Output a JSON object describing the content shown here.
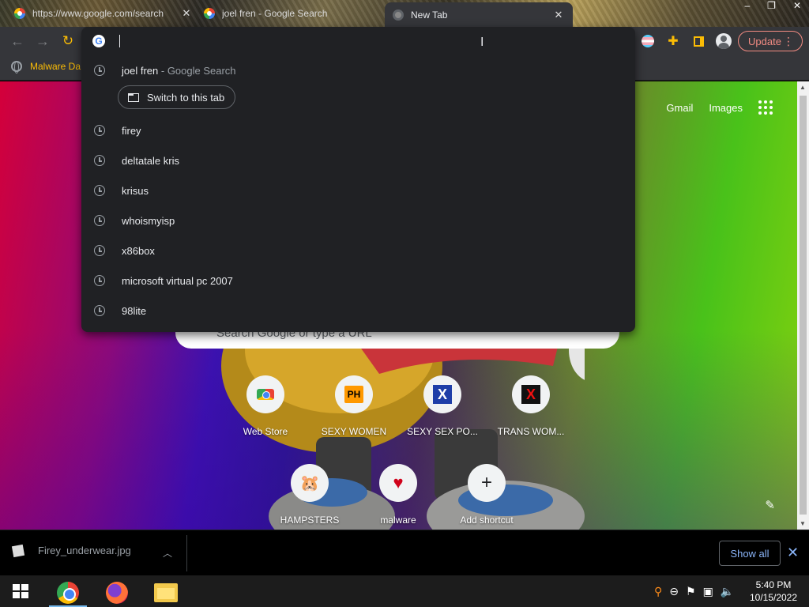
{
  "tabs": [
    {
      "title": "https://www.google.com/search",
      "icon": "google-icon"
    },
    {
      "title": "joel fren - Google Search",
      "icon": "google-icon"
    },
    {
      "title": "New Tab",
      "icon": "chrome-icon"
    }
  ],
  "window_controls": {
    "minimize": "–",
    "maximize": "❐",
    "close": "✕"
  },
  "toolbar": {
    "back": "←",
    "forward": "→",
    "reload": "↻",
    "update_label": "Update",
    "menu": "⋮"
  },
  "bookmarks": [
    {
      "label": "Malware Da",
      "icon": "globe-icon"
    }
  ],
  "omnibox": {
    "input_value": "",
    "suggestions": [
      {
        "text": "joel fren",
        "desc": "- Google Search",
        "icon": "history-icon"
      },
      {
        "text": "firey",
        "desc": "",
        "icon": "history-icon"
      },
      {
        "text": "deltatale kris",
        "desc": "",
        "icon": "history-icon"
      },
      {
        "text": "krisus",
        "desc": "",
        "icon": "history-icon"
      },
      {
        "text": "whoismyisp",
        "desc": "",
        "icon": "history-icon"
      },
      {
        "text": "x86box",
        "desc": "",
        "icon": "history-icon"
      },
      {
        "text": "microsoft virtual pc 2007",
        "desc": "",
        "icon": "history-icon"
      },
      {
        "text": "98lite",
        "desc": "",
        "icon": "history-icon"
      }
    ],
    "switch_tab_label": "Switch to this tab"
  },
  "newtab": {
    "links": {
      "gmail": "Gmail",
      "images": "Images"
    },
    "search_placeholder": "Search Google or type a URL",
    "shortcuts": [
      {
        "label": "Web Store",
        "icon": "web-store-icon"
      },
      {
        "label": "SEXY WOMEN",
        "icon": "ph-icon",
        "glyph": "PH"
      },
      {
        "label": "SEXY SEX PO...",
        "icon": "x-blue-icon",
        "glyph": "X"
      },
      {
        "label": "TRANS WOM...",
        "icon": "x-red-icon",
        "glyph": "X"
      },
      {
        "label": "HAMPSTERS",
        "icon": "hamster-icon",
        "glyph": "🐹"
      },
      {
        "label": "malware",
        "icon": "heart-icon",
        "glyph": "♥"
      },
      {
        "label": "Add shortcut",
        "icon": "plus-icon",
        "glyph": "+"
      }
    ]
  },
  "downloads": {
    "file_name": "Firey_underwear.jpg",
    "show_all_label": "Show all"
  },
  "taskbar": {
    "apps": [
      {
        "name": "chrome-icon"
      },
      {
        "name": "firefox-icon"
      },
      {
        "name": "file-explorer-icon"
      }
    ],
    "time": "5:40 PM",
    "date": "10/15/2022"
  }
}
